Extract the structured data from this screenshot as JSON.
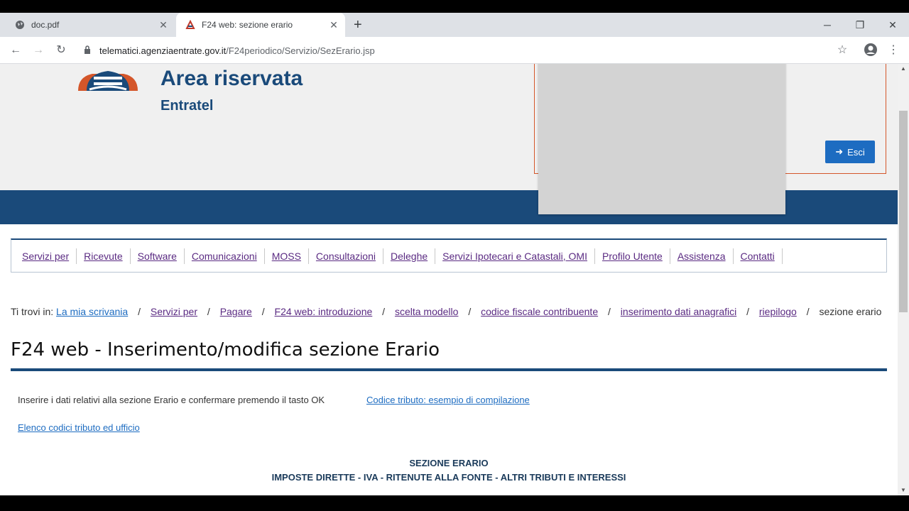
{
  "browser": {
    "tabs": [
      {
        "title": "doc.pdf",
        "active": false
      },
      {
        "title": "F24 web: sezione erario",
        "active": true
      }
    ],
    "url_host": "telematici.agenziaentrate.gov.it",
    "url_path": "/F24periodico/Servizio/SezErario.jsp"
  },
  "header": {
    "title": "Area riservata",
    "subtitle": "Entratel",
    "exit_label": "Esci",
    "colors": {
      "brand": "#1a4a7a",
      "accent_border": "#d4562a",
      "button": "#1d6cc1"
    }
  },
  "menu": {
    "items": [
      "Servizi per",
      "Ricevute",
      "Software",
      "Comunicazioni",
      "MOSS",
      "Consultazioni",
      "Deleghe",
      "Servizi Ipotecari e Catastali, OMI",
      "Profilo Utente",
      "Assistenza",
      "Contatti"
    ]
  },
  "breadcrumb": {
    "prefix": "Ti trovi in:",
    "items": [
      "La mia scrivania",
      "Servizi per",
      "Pagare",
      "F24 web: introduzione",
      "scelta modello",
      "codice fiscale contribuente",
      "inserimento dati anagrafici",
      "riepilogo"
    ],
    "current": "sezione erario"
  },
  "main": {
    "title": "F24 web - Inserimento/modifica sezione Erario",
    "intro": "Inserire i dati relativi alla sezione Erario e confermare premendo il tasto OK",
    "link_example": "Codice tributo: esempio di compilazione",
    "link_codes": "Elenco codici tributo ed ufficio",
    "section_title": "SEZIONE ERARIO",
    "section_subtitle": "IMPOSTE DIRETTE - IVA - RITENUTE ALLA FONTE - ALTRI TRIBUTI E INTERESSI"
  }
}
